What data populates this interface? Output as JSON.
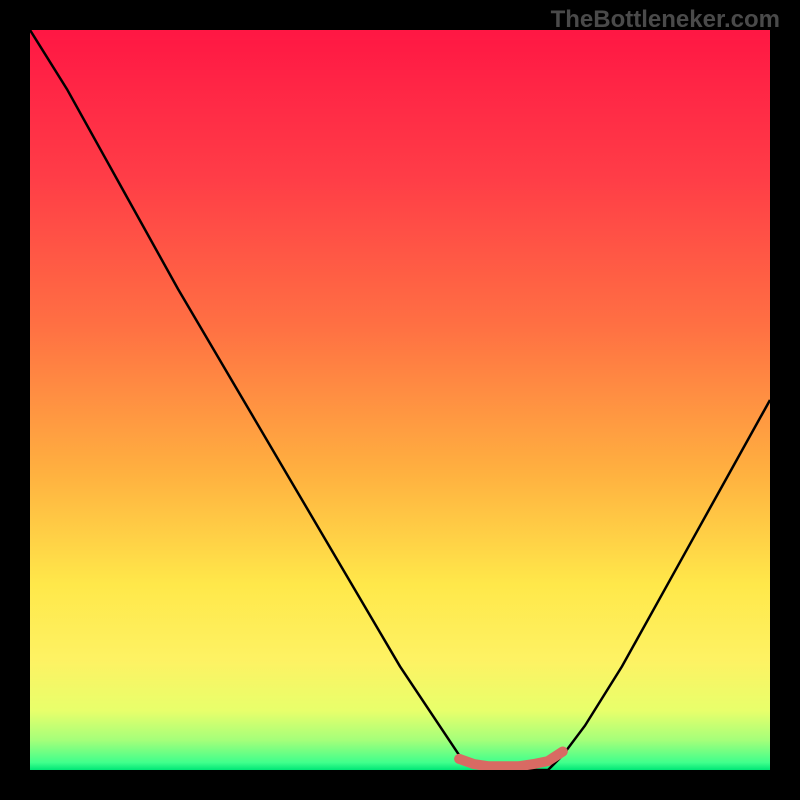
{
  "watermark": "TheBottleneker.com",
  "chart_data": {
    "type": "line",
    "title": "",
    "xlabel": "",
    "ylabel": "",
    "xlim": [
      0,
      100
    ],
    "ylim": [
      0,
      100
    ],
    "gradient_stops": [
      {
        "offset": 0,
        "color": "#ff1744"
      },
      {
        "offset": 20,
        "color": "#ff3d47"
      },
      {
        "offset": 40,
        "color": "#ff7043"
      },
      {
        "offset": 60,
        "color": "#ffb140"
      },
      {
        "offset": 75,
        "color": "#ffe84a"
      },
      {
        "offset": 85,
        "color": "#fef263"
      },
      {
        "offset": 92,
        "color": "#e8ff6b"
      },
      {
        "offset": 96,
        "color": "#a4ff7a"
      },
      {
        "offset": 99,
        "color": "#40ff8c"
      },
      {
        "offset": 100,
        "color": "#00e676"
      }
    ],
    "series": [
      {
        "name": "bottleneck-curve",
        "color": "#000000",
        "x": [
          0,
          5,
          10,
          15,
          20,
          25,
          30,
          35,
          40,
          45,
          50,
          55,
          58,
          62,
          66,
          70,
          72,
          75,
          80,
          85,
          90,
          95,
          100
        ],
        "y": [
          100,
          92,
          83,
          74,
          65,
          56.5,
          48,
          39.5,
          31,
          22.5,
          14,
          6.5,
          2,
          0,
          0,
          0,
          2,
          6,
          14,
          23,
          32,
          41,
          50
        ]
      },
      {
        "name": "optimal-marker",
        "color": "#d86a63",
        "type": "marker-line",
        "x": [
          58,
          60,
          62,
          64,
          66,
          68,
          70,
          72
        ],
        "y": [
          1.5,
          0.8,
          0.5,
          0.5,
          0.5,
          0.8,
          1.2,
          2.5
        ]
      }
    ]
  }
}
